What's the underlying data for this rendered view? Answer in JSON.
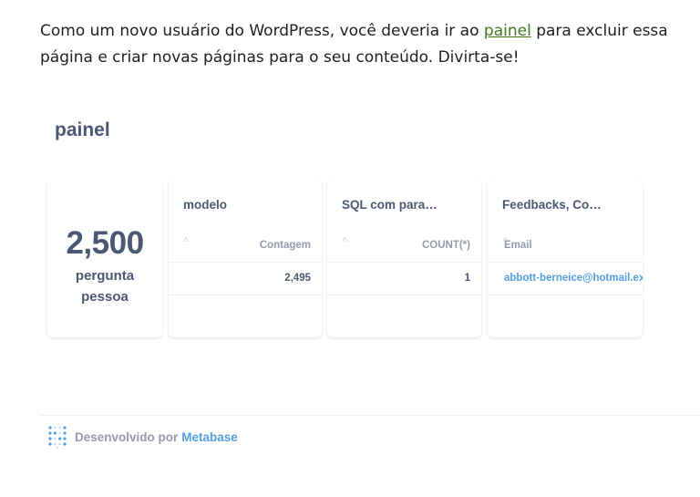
{
  "intro": {
    "before": "Como um novo usuário do WordPress, você deveria ir ao ",
    "link": "painel",
    "after": " para excluir essa página e criar novas páginas para o seu conteúdo. Divirta-se!"
  },
  "dashboard": {
    "title": "painel",
    "scalar": {
      "value": "2,500",
      "label_line1": "pergunta",
      "label_line2": "pessoa"
    },
    "cards": [
      {
        "title": "modelo",
        "sort_icon": "^",
        "column": "Contagem",
        "cell": "2,495"
      },
      {
        "title": "SQL com para…",
        "sort_icon": "^",
        "column": "COUNT(*)",
        "cell": "1"
      },
      {
        "title": "Feedbacks, Co…",
        "sort_icon": "^",
        "column": "Email",
        "cell": "abbott-berneice@hotmail.ex"
      }
    ]
  },
  "footer": {
    "prefix": "Desenvolvido por",
    "brand": "Metabase",
    "logo_icon": "metabase-logo-icon"
  },
  "colors": {
    "text_dark": "#4c5773",
    "text_muted": "#949aab",
    "brand_blue": "#509ee3",
    "link_green": "#3f7a1f"
  }
}
